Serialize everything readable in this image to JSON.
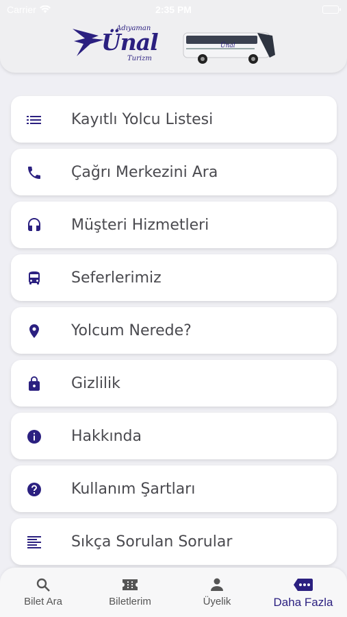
{
  "status_bar": {
    "carrier": "Carrier",
    "time": "2:35 PM"
  },
  "brand": {
    "logo_small": "Adıyaman",
    "logo_main": "Ünal",
    "logo_sub": "Turizm",
    "bus_text": "Ünal"
  },
  "accent_color": "#2b2080",
  "menu": [
    {
      "label": "Kayıtlı Yolcu Listesi",
      "icon": "list-icon"
    },
    {
      "label": "Çağrı Merkezini Ara",
      "icon": "phone-icon"
    },
    {
      "label": "Müşteri Hizmetleri",
      "icon": "headset-icon"
    },
    {
      "label": "Seferlerimiz",
      "icon": "bus-icon"
    },
    {
      "label": "Yolcum Nerede?",
      "icon": "location-pin-icon"
    },
    {
      "label": "Gizlilik",
      "icon": "lock-icon"
    },
    {
      "label": "Hakkında",
      "icon": "info-icon"
    },
    {
      "label": "Kullanım Şartları",
      "icon": "help-icon"
    },
    {
      "label": "Sıkça Sorulan Sorular",
      "icon": "text-lines-icon"
    }
  ],
  "tabs": [
    {
      "label": "Bilet Ara",
      "icon": "search-icon",
      "active": false
    },
    {
      "label": "Biletlerim",
      "icon": "ticket-icon",
      "active": false
    },
    {
      "label": "Üyelik",
      "icon": "user-icon",
      "active": false
    },
    {
      "label": "Daha Fazla",
      "icon": "more-icon",
      "active": true
    }
  ]
}
